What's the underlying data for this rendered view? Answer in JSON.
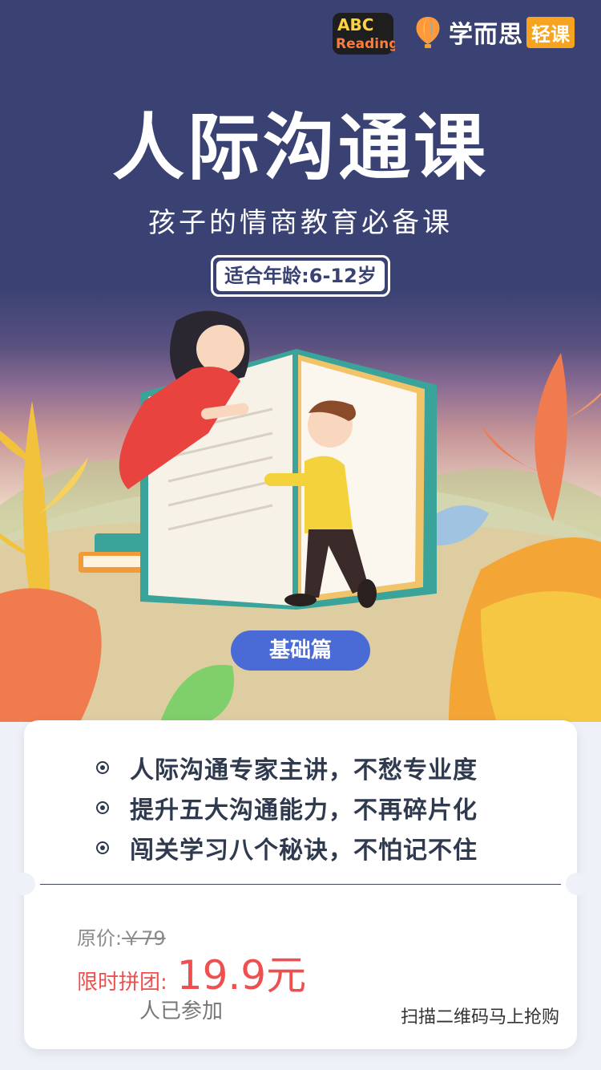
{
  "header": {
    "abc_logo_top": "ABC",
    "abc_logo_bottom": "Reading",
    "brand_name": "学而思",
    "brand_tag": "轻课"
  },
  "hero": {
    "title": "人际沟通课",
    "subtitle": "孩子的情商教育必备课",
    "age_label": "适合年龄:6-12岁",
    "level_label": "基础篇"
  },
  "features": [
    {
      "text": "人际沟通专家主讲，不愁专业度"
    },
    {
      "text": "提升五大沟通能力，不再碎片化"
    },
    {
      "text": "闯关学习八个秘诀，不怕记不住"
    }
  ],
  "pricing": {
    "original_label": "原价:",
    "original_price": "￥79",
    "promo_label": "限时拼团:",
    "promo_price": "19.9元",
    "joined_text": "人已参加",
    "scan_text": "扫描二维码马上抢购"
  },
  "colors": {
    "navy": "#3a4273",
    "accent_red": "#ee4f4f",
    "pill_blue": "#4a6bd6",
    "brand_orange": "#f6a31f"
  }
}
